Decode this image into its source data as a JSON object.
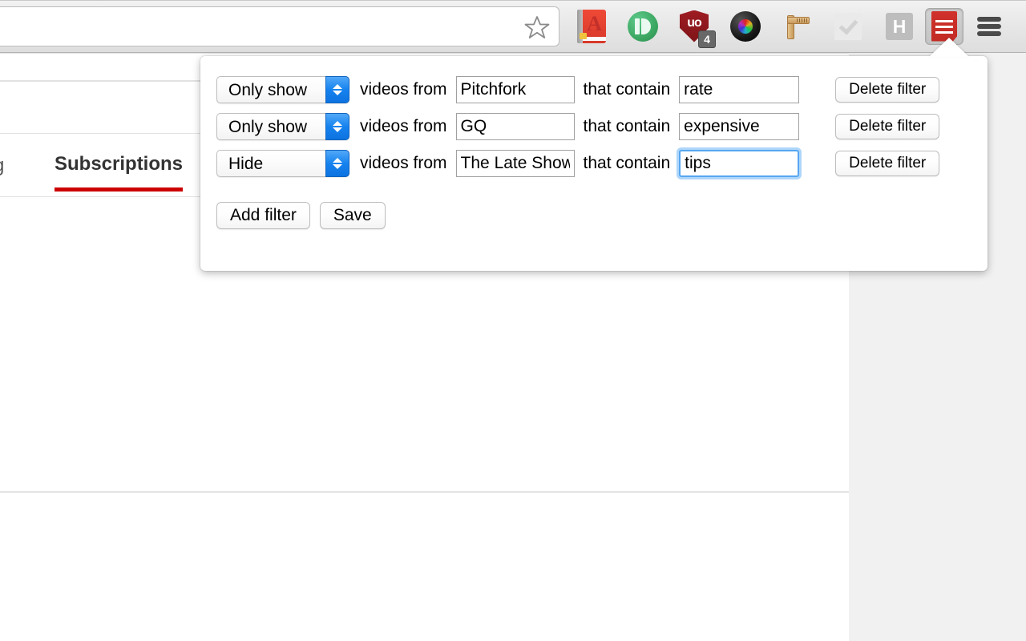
{
  "browser": {
    "urlbar": {
      "value": "",
      "placeholder": ""
    },
    "star_icon": "star-icon",
    "extensions": [
      {
        "name": "dictionary-extension-icon",
        "letter": "A",
        "badge": ""
      },
      {
        "name": "pushbullet-extension-icon",
        "letter": "",
        "badge": ""
      },
      {
        "name": "ublock-origin-extension-icon",
        "letter": "uo",
        "badge": "4"
      },
      {
        "name": "camera-lens-extension-icon",
        "letter": "",
        "badge": ""
      },
      {
        "name": "ruler-extension-icon",
        "letter": "",
        "badge": ""
      },
      {
        "name": "checkmark-extension-icon",
        "letter": "",
        "badge": ""
      },
      {
        "name": "h-extension-icon",
        "letter": "H",
        "badge": ""
      },
      {
        "name": "video-filter-extension-icon",
        "letter": "",
        "badge": ""
      }
    ],
    "menu_icon": "hamburger-menu-icon"
  },
  "page": {
    "tab_previous_partial": "g",
    "active_tab": "Subscriptions",
    "accent_color": "#cc0000"
  },
  "popup": {
    "row_label_from": "videos from",
    "row_label_contain": "that contain",
    "delete_label": "Delete filter",
    "add_filter_label": "Add filter",
    "save_label": "Save",
    "action_options": [
      "Only show",
      "Hide"
    ],
    "filters": [
      {
        "action": "Only show",
        "channel": "Pitchfork",
        "keyword": "rate",
        "focused": false
      },
      {
        "action": "Only show",
        "channel": "GQ",
        "keyword": "expensive",
        "focused": false
      },
      {
        "action": "Hide",
        "channel": "The Late Show with Stephen Colbert",
        "keyword": "tips",
        "focused": true
      }
    ]
  }
}
